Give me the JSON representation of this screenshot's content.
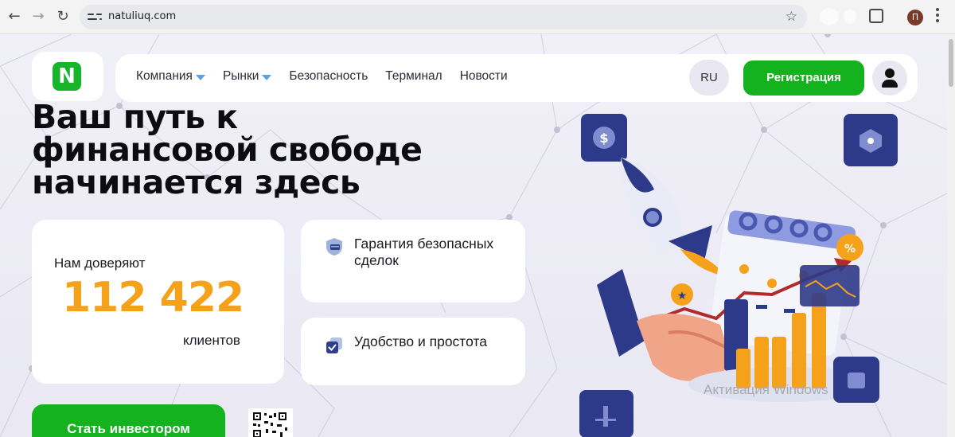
{
  "browser": {
    "url": "natuliuq.com",
    "profile_initial": "П"
  },
  "brand": {
    "logo_letter": "N",
    "accent": "#14b21f"
  },
  "nav": {
    "items": [
      {
        "label": "Компания",
        "dropdown": true
      },
      {
        "label": "Рынки",
        "dropdown": true
      },
      {
        "label": "Безопасность",
        "dropdown": false
      },
      {
        "label": "Терминал",
        "dropdown": false
      },
      {
        "label": "Новости",
        "dropdown": false
      }
    ],
    "language": "RU",
    "register_label": "Регистрация"
  },
  "hero": {
    "title_lines": [
      "Ваш путь к",
      "финансовой свободе",
      "начинается здесь"
    ],
    "trust": {
      "label": "Нам доверяют",
      "count": "112 422",
      "suffix": "клиентов",
      "count_color": "#f5a21a"
    },
    "features": [
      {
        "text": "Гарантия безопасных сделок",
        "icon": "shield-icon"
      },
      {
        "text": "Удобство и простота",
        "icon": "checkbox-icon"
      }
    ],
    "cta_label": "Стать инвестором"
  },
  "illustration": {
    "percent_badge": "%",
    "dollar_badge": "$"
  },
  "os_watermark": "Активация Windows"
}
